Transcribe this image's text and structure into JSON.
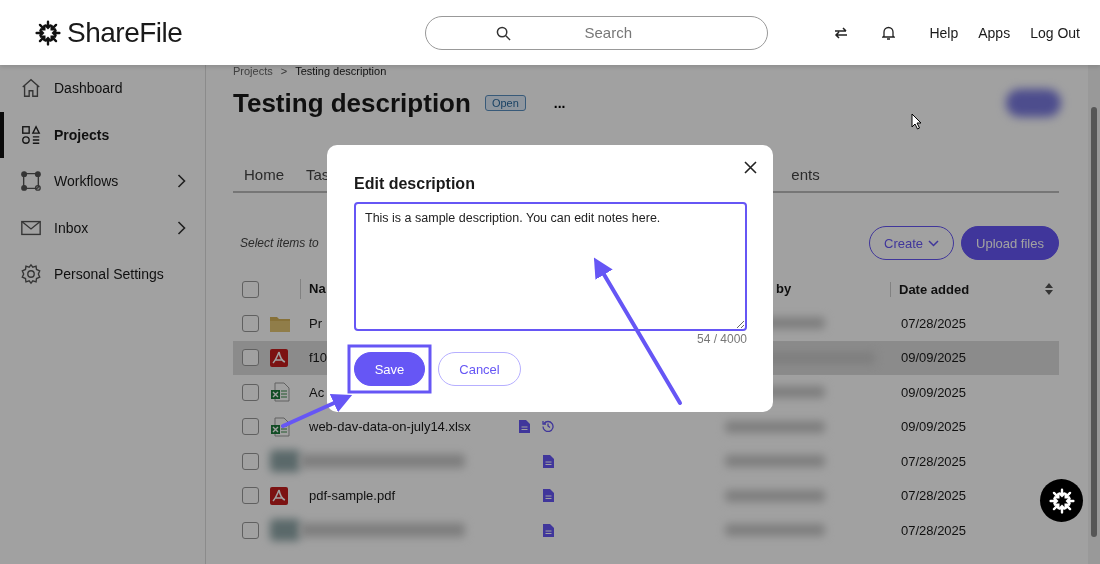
{
  "header": {
    "logo": "ShareFile",
    "search": {
      "placeholder": "Search"
    },
    "links": [
      "Help",
      "Apps",
      "Log Out"
    ]
  },
  "sidebar": {
    "items": [
      {
        "label": "Dashboard",
        "kind": "home",
        "selected": false,
        "expandable": false
      },
      {
        "label": "Projects",
        "kind": "projects",
        "selected": true,
        "expandable": false
      },
      {
        "label": "Workflows",
        "kind": "workflows",
        "selected": false,
        "expandable": true
      },
      {
        "label": "Inbox",
        "kind": "inbox",
        "selected": false,
        "expandable": true
      },
      {
        "label": "Personal Settings",
        "kind": "settings",
        "selected": false,
        "expandable": false
      }
    ]
  },
  "breadcrumb": {
    "items": [
      "Projects",
      "Testing description"
    ],
    "separator": ">"
  },
  "project": {
    "title": "Testing description",
    "status": "Open",
    "more": "..."
  },
  "tabs": [
    "Home",
    "Tas",
    "ents"
  ],
  "toolbar": {
    "hint": "Select items to",
    "buttons": [
      {
        "label": "Create",
        "kind": "dropdown"
      },
      {
        "label": "Upload files",
        "kind": "primary"
      }
    ]
  },
  "table": {
    "all_checked": false,
    "columns": [
      {
        "label": "Na"
      },
      {
        "label": "by"
      },
      {
        "label": "Date added",
        "sortable": true
      }
    ],
    "rows": [
      {
        "kind": "folder",
        "name": "Pr",
        "date": "07/28/2025",
        "checked": false,
        "selected": false
      },
      {
        "kind": "pdf",
        "name": "f10",
        "date": "09/09/2025",
        "checked": false,
        "selected": true
      },
      {
        "kind": "excel",
        "name": "Ac",
        "date": "09/09/2025",
        "checked": false,
        "selected": false
      },
      {
        "kind": "excel",
        "name": "web-dav-data-on-july14.xlsx",
        "note": true,
        "history": true,
        "date": "09/09/2025",
        "checked": false,
        "selected": false
      },
      {
        "kind": "redacted",
        "note": true,
        "history": false,
        "date": "07/28/2025",
        "checked": false,
        "selected": false
      },
      {
        "kind": "pdf",
        "name": "pdf-sample.pdf",
        "note": true,
        "history": false,
        "date": "07/28/2025",
        "checked": false,
        "selected": false
      },
      {
        "kind": "redacted",
        "note": true,
        "history": false,
        "date": "07/28/2025",
        "checked": false,
        "selected": false
      }
    ]
  },
  "dialog": {
    "title": "Edit description",
    "value": "This is a sample description. You can edit notes here.",
    "counter": "54 / 4000",
    "buttons": [
      {
        "label": "Save",
        "kind": "primary"
      },
      {
        "label": "Cancel",
        "kind": "secondary"
      }
    ]
  }
}
